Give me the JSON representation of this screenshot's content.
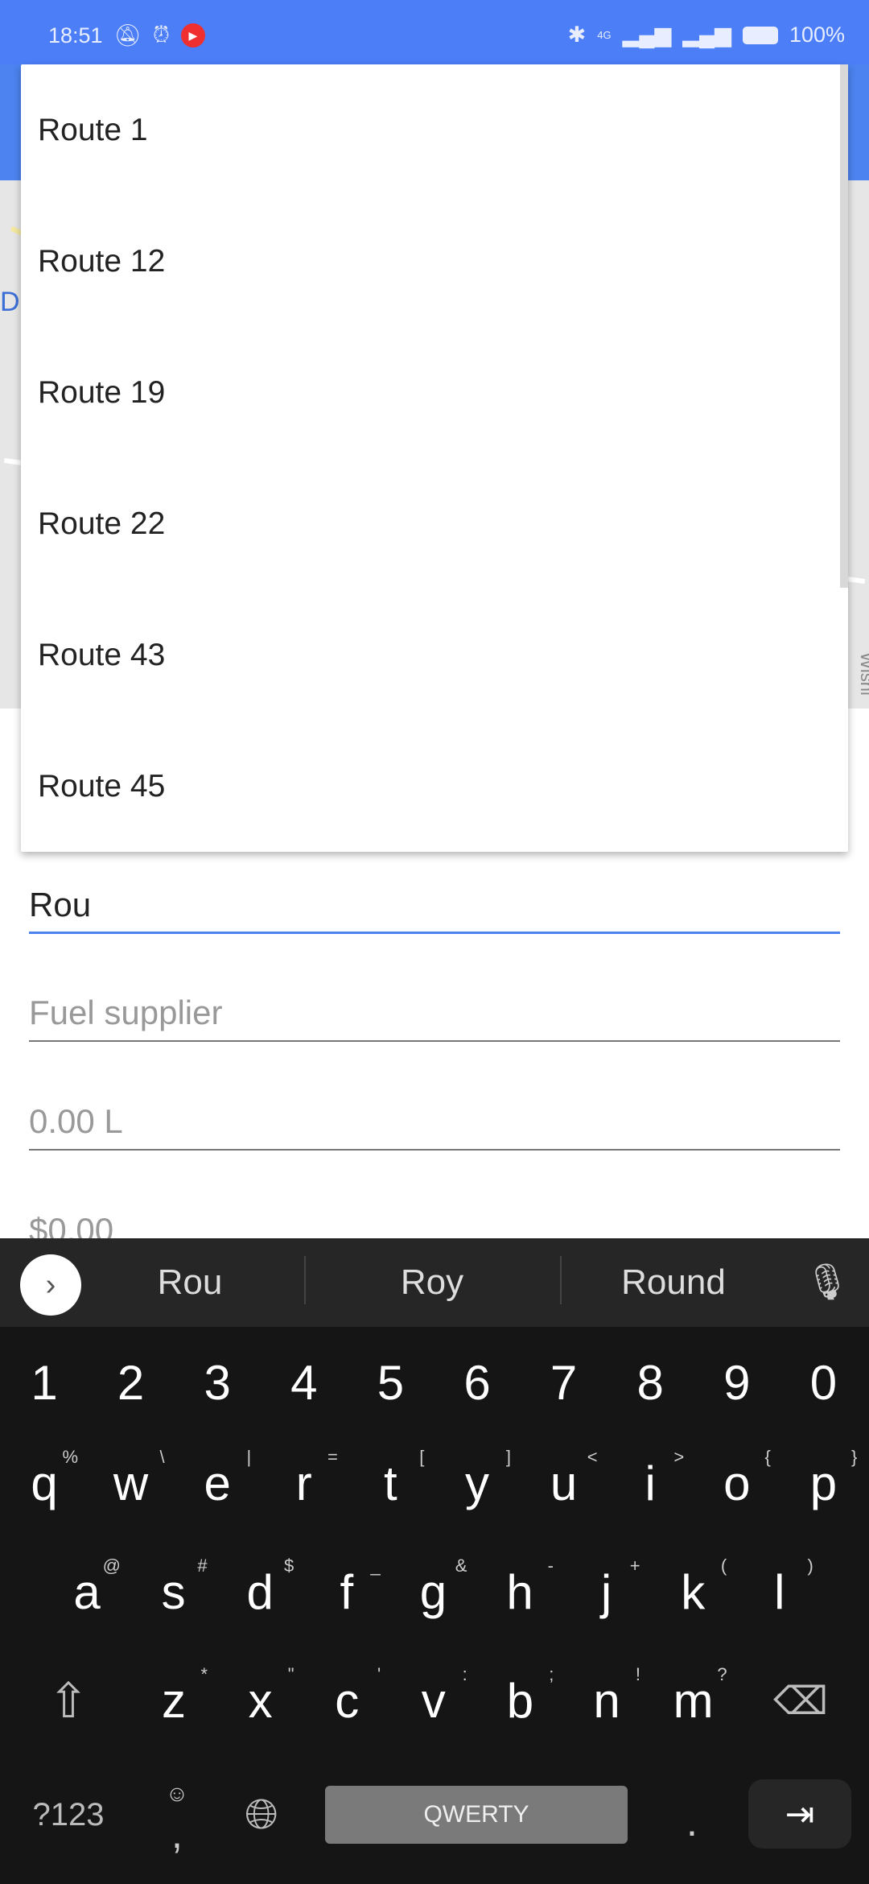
{
  "status_bar": {
    "time": "18:51",
    "battery": "100%",
    "network": "4G",
    "icons": [
      "mute-bell-icon",
      "alarm-icon",
      "youtube-icon",
      "bluetooth-icon",
      "signal-icon",
      "signal-icon",
      "battery-icon"
    ]
  },
  "map": {
    "labels": [
      "D.",
      "Wisni"
    ]
  },
  "dropdown": {
    "items": [
      "Route 1",
      "Route 12",
      "Route 19",
      "Route 22",
      "Route 43",
      "Route 45"
    ]
  },
  "form": {
    "route_value": "Rou",
    "fuel_supplier_placeholder": "Fuel supplier",
    "volume_placeholder": "0.00 L",
    "cost_placeholder": "$0.00"
  },
  "keyboard": {
    "suggestions": [
      "Rou",
      "Roy",
      "Round"
    ],
    "number_row": [
      "1",
      "2",
      "3",
      "4",
      "5",
      "6",
      "7",
      "8",
      "9",
      "0"
    ],
    "row1": [
      [
        "q",
        "%"
      ],
      [
        "w",
        "\\"
      ],
      [
        "e",
        "|"
      ],
      [
        "r",
        "="
      ],
      [
        "t",
        "["
      ],
      [
        "y",
        "]"
      ],
      [
        "u",
        "<"
      ],
      [
        "i",
        ">"
      ],
      [
        "o",
        "{"
      ],
      [
        "p",
        "}"
      ]
    ],
    "row2": [
      [
        "a",
        "@"
      ],
      [
        "s",
        "#"
      ],
      [
        "d",
        "$"
      ],
      [
        "f",
        "_"
      ],
      [
        "g",
        "&"
      ],
      [
        "h",
        "-"
      ],
      [
        "j",
        "+"
      ],
      [
        "k",
        "("
      ],
      [
        "l",
        ")"
      ]
    ],
    "row3": [
      [
        "z",
        "*"
      ],
      [
        "x",
        "\""
      ],
      [
        "c",
        "'"
      ],
      [
        "v",
        ":"
      ],
      [
        "b",
        ";"
      ],
      [
        "n",
        "!"
      ],
      [
        "m",
        "?"
      ]
    ],
    "symbols_key": "?123",
    "comma_key": ",",
    "space_label": "QWERTY",
    "period_key": ".",
    "accent": "#4c83f0"
  }
}
